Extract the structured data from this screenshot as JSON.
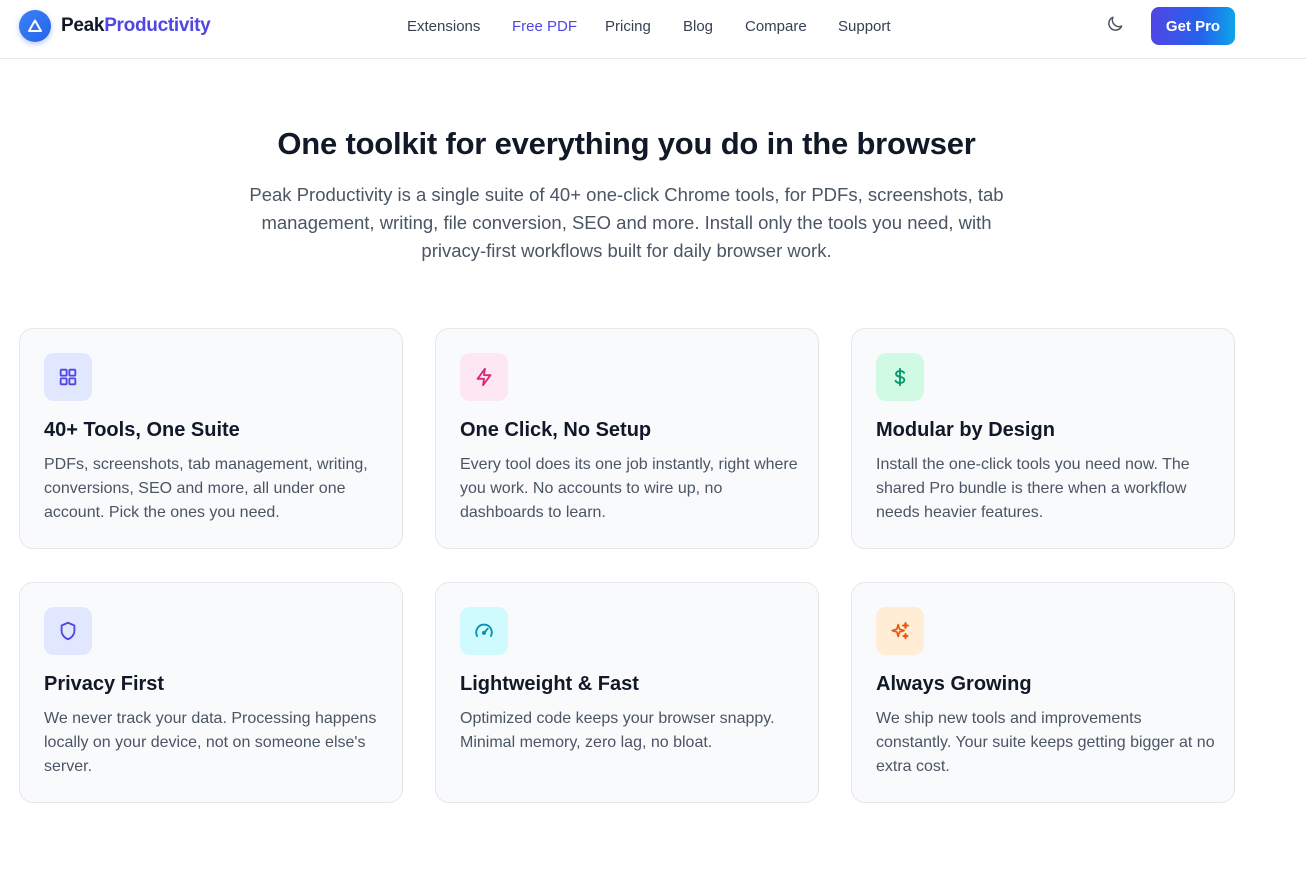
{
  "brand": {
    "name_part1": "Peak",
    "name_part2": "Productivity",
    "colors": {
      "primary": "#4f46e5",
      "blue": "#2563eb"
    }
  },
  "nav": {
    "links": [
      {
        "label": "Extensions",
        "active": false
      },
      {
        "label": "Free PDF",
        "active": true
      },
      {
        "label": "Pricing",
        "active": false
      },
      {
        "label": "Blog",
        "active": false
      },
      {
        "label": "Compare",
        "active": false
      },
      {
        "label": "Support",
        "active": false
      }
    ],
    "theme_icon": "moon-icon",
    "cta_label": "Get Pro"
  },
  "hero": {
    "title": "One toolkit for everything you do in the browser",
    "subtitle": "Peak Productivity is a single suite of 40+ one-click Chrome tools, for PDFs, screenshots, tab management, writing, file conversion, SEO and more. Install only the tools you need, with privacy-first workflows built for daily browser work."
  },
  "features": [
    {
      "icon": "grid-icon",
      "title": "40+ Tools, One Suite",
      "description": "PDFs, screenshots, tab management, writing, conversions, SEO and more, all under one account. Pick the ones you need.",
      "icon_bg": "#e0e7ff",
      "icon_color": "#4f46e5"
    },
    {
      "icon": "lightning-icon",
      "title": "One Click, No Setup",
      "description": "Every tool does its one job instantly, right where you work. No accounts to wire up, no dashboards to learn.",
      "icon_bg": "#fce7f3",
      "icon_color": "#db2777"
    },
    {
      "icon": "dollar-icon",
      "title": "Modular by Design",
      "description": "Install the one-click tools you need now. The shared Pro bundle is there when a workflow needs heavier features.",
      "icon_bg": "#d1fae5",
      "icon_color": "#059669"
    },
    {
      "icon": "shield-icon",
      "title": "Privacy First",
      "description": "We never track your data. Processing happens locally on your device, not on someone else's server.",
      "icon_bg": "#e0e7ff",
      "icon_color": "#4f46e5"
    },
    {
      "icon": "speedometer-icon",
      "title": "Lightweight & Fast",
      "description": "Optimized code keeps your browser snappy. Minimal memory, zero lag, no bloat.",
      "icon_bg": "#cffafe",
      "icon_color": "#0891b2"
    },
    {
      "icon": "sparkles-icon",
      "title": "Always Growing",
      "description": "We ship new tools and improvements constantly. Your suite keeps getting bigger at no extra cost.",
      "icon_bg": "#ffedd5",
      "icon_color": "#ea580c"
    }
  ]
}
